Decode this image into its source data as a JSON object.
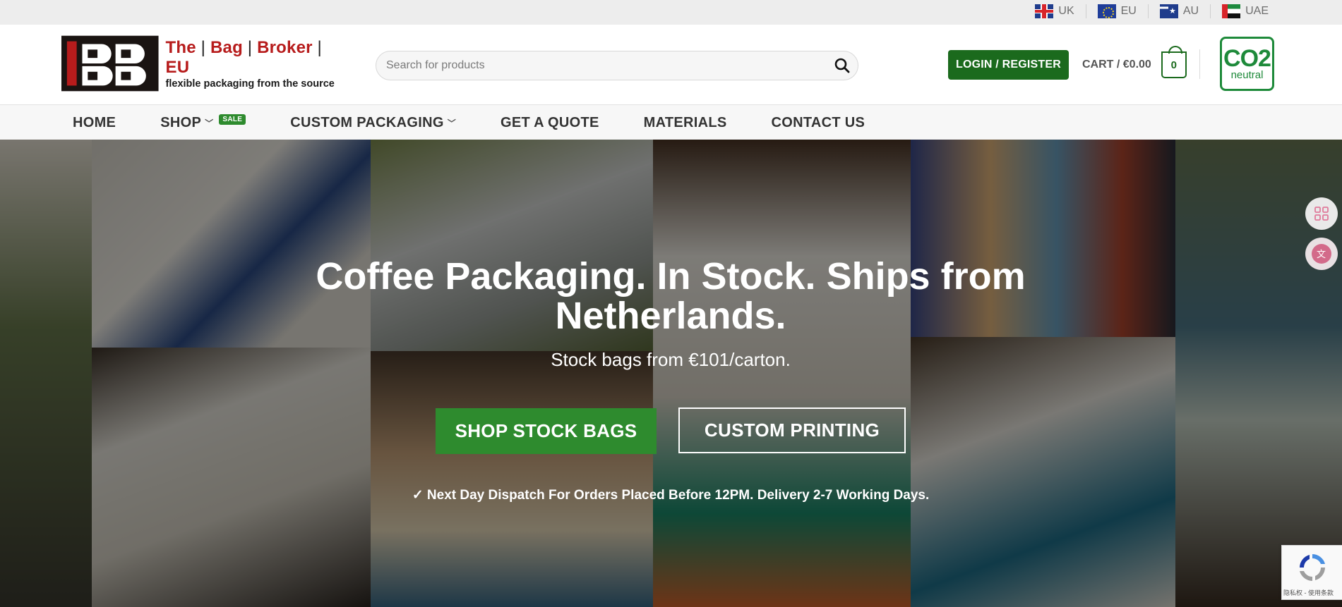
{
  "regions": [
    {
      "label": "UK",
      "flag": "flag-uk-icon"
    },
    {
      "label": "EU",
      "flag": "flag-eu-icon"
    },
    {
      "label": "AU",
      "flag": "flag-au-icon"
    },
    {
      "label": "UAE",
      "flag": "flag-uae-icon"
    }
  ],
  "logo": {
    "name_parts": [
      "The",
      "Bag",
      "Broker",
      "EU"
    ],
    "tagline": "flexible packaging from the source"
  },
  "search": {
    "placeholder": "Search for products"
  },
  "header": {
    "login_label": "LOGIN / REGISTER",
    "cart_label": "CART / €0.00",
    "cart_count": "0",
    "co2_label": "CO2",
    "co2_sub": "neutral"
  },
  "nav": {
    "items": [
      {
        "label": "HOME"
      },
      {
        "label": "SHOP",
        "badge": "SALE"
      },
      {
        "label": "CUSTOM PACKAGING"
      },
      {
        "label": "GET A QUOTE"
      },
      {
        "label": "MATERIALS"
      },
      {
        "label": "CONTACT US"
      }
    ]
  },
  "hero": {
    "title": "Coffee Packaging. In Stock. Ships from Netherlands.",
    "subtitle": "Stock bags from €101/carton.",
    "primary_button": "SHOP STOCK BAGS",
    "secondary_button": "CUSTOM PRINTING",
    "dispatch_note": "✓ Next Day Dispatch For Orders Placed Before 12PM. Delivery 2-7 Working Days."
  },
  "recaptcha": {
    "text": "隐私权 - 使用条款"
  },
  "colors": {
    "brand_green": "#2e8b2e",
    "login_green": "#1b6a1d",
    "logo_red": "#b71c1c",
    "topbar_bg": "#ededed"
  }
}
